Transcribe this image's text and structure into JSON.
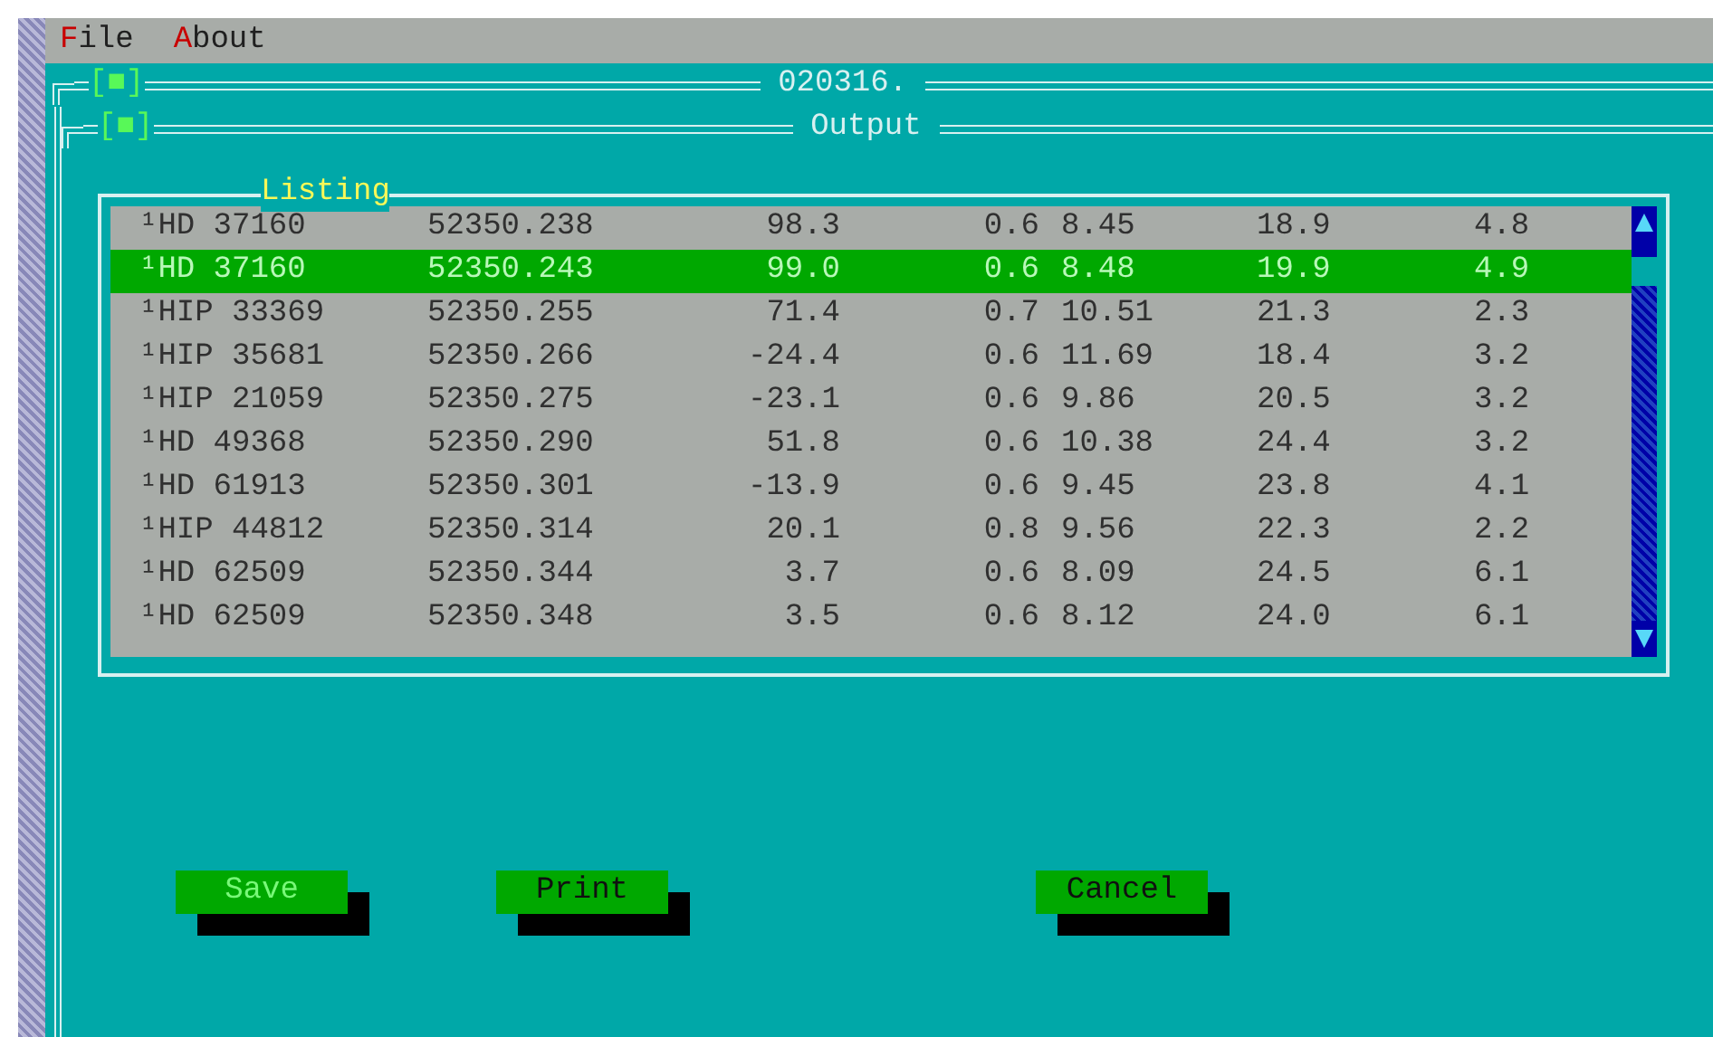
{
  "menu": [
    {
      "label": "File"
    },
    {
      "label": "About"
    }
  ],
  "windows": [
    {
      "title": "020316.",
      "close_box": "[■]"
    },
    {
      "title": "Output",
      "close_box": "[■]"
    }
  ],
  "listing": {
    "title": "Listing",
    "rows": [
      {
        "selected": false,
        "cells": [
          "¹HD 37160",
          "52350.238",
          "98.3",
          "0.6",
          "8.45",
          "18.9",
          "4.8"
        ]
      },
      {
        "selected": true,
        "cells": [
          "¹HD 37160",
          "52350.243",
          "99.0",
          "0.6",
          "8.48",
          "19.9",
          "4.9"
        ]
      },
      {
        "selected": false,
        "cells": [
          "¹HIP 33369",
          "52350.255",
          "71.4",
          "0.7",
          "10.51",
          "21.3",
          "2.3"
        ]
      },
      {
        "selected": false,
        "cells": [
          "¹HIP 35681",
          "52350.266",
          "-24.4",
          "0.6",
          "11.69",
          "18.4",
          "3.2"
        ]
      },
      {
        "selected": false,
        "cells": [
          "¹HIP 21059",
          "52350.275",
          "-23.1",
          "0.6",
          "9.86",
          "20.5",
          "3.2"
        ]
      },
      {
        "selected": false,
        "cells": [
          "¹HD 49368",
          "52350.290",
          "51.8",
          "0.6",
          "10.38",
          "24.4",
          "3.2"
        ]
      },
      {
        "selected": false,
        "cells": [
          "¹HD 61913",
          "52350.301",
          "-13.9",
          "0.6",
          "9.45",
          "23.8",
          "4.1"
        ]
      },
      {
        "selected": false,
        "cells": [
          "¹HIP 44812",
          "52350.314",
          "20.1",
          "0.8",
          "9.56",
          "22.3",
          "2.2"
        ]
      },
      {
        "selected": false,
        "cells": [
          "¹HD 62509",
          "52350.344",
          "3.7",
          "0.6",
          "8.09",
          "24.5",
          "6.1"
        ]
      },
      {
        "selected": false,
        "cells": [
          "¹HD 62509",
          "52350.348",
          "3.5",
          "0.6",
          "8.12",
          "24.0",
          "6.1"
        ]
      }
    ]
  },
  "buttons": [
    {
      "label": "Save",
      "focused": true
    },
    {
      "label": "Print",
      "focused": false
    },
    {
      "label": "Cancel",
      "focused": false
    }
  ]
}
